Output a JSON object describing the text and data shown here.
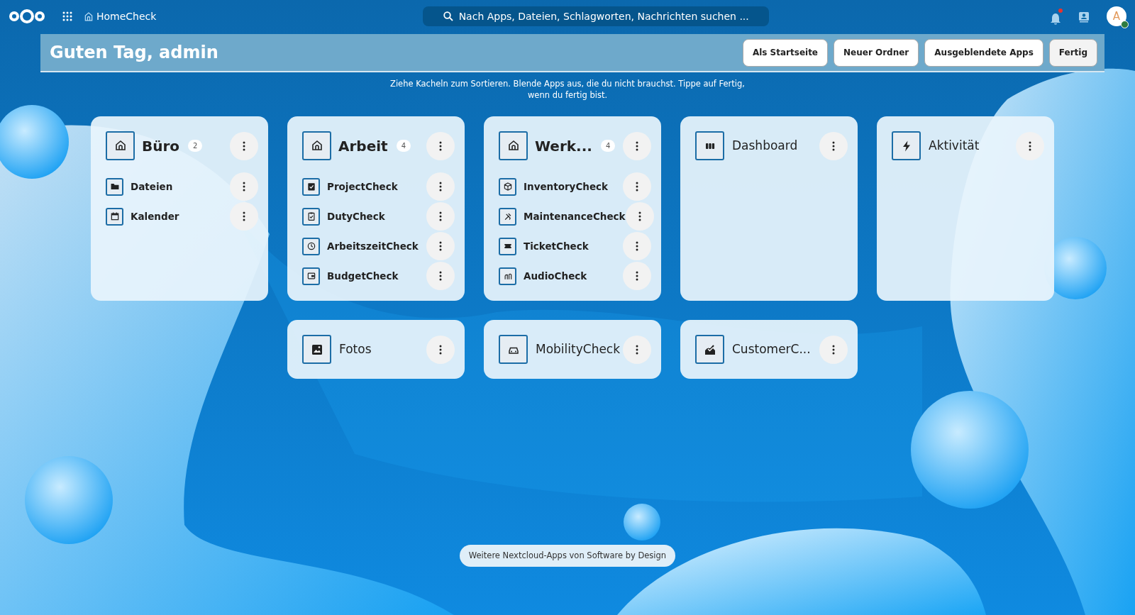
{
  "topbar": {
    "app_name": "HomeCheck",
    "search": {
      "placeholder": "Nach Apps, Dateien, Schlagworten, Nachrichten suchen ..."
    },
    "notifications_unread": true,
    "avatar": {
      "initial": "A",
      "online": true
    }
  },
  "greeting": {
    "title": "Guten Tag, admin",
    "buttons": [
      {
        "label": "Als Startseite",
        "selected": false
      },
      {
        "label": "Neuer Ordner",
        "selected": false
      },
      {
        "label": "Ausgeblendete Apps",
        "selected": false
      },
      {
        "label": "Fertig",
        "selected": true
      }
    ]
  },
  "hint": [
    "Ziehe Kacheln zum Sortieren. Blende Apps aus, die du nicht brauchst. Tippe auf Fertig,",
    "wenn du fertig bist."
  ],
  "tiles": [
    {
      "kind": "folder",
      "title": "Büro",
      "count": "2",
      "items": [
        "Dateien",
        "Kalender"
      ]
    },
    {
      "kind": "folder",
      "title": "Arbeit",
      "count": "4",
      "items": [
        "ProjectCheck",
        "DutyCheck",
        "ArbeitszeitCheck",
        "BudgetCheck"
      ]
    },
    {
      "kind": "folder",
      "title": "Werk...",
      "count": "4",
      "items": [
        "InventoryCheck",
        "MaintenanceCheck",
        "TicketCheck",
        "AudioCheck"
      ]
    },
    {
      "kind": "app",
      "title": "Dashboard"
    },
    {
      "kind": "app",
      "title": "Aktivität"
    },
    {
      "kind": "spacer"
    },
    {
      "kind": "app",
      "title": "Fotos"
    },
    {
      "kind": "app",
      "title": "MobilityCheck"
    },
    {
      "kind": "app",
      "title": "CustomerC..."
    }
  ],
  "footer_link": "Weitere Nextcloud-Apps von Software by Design"
}
